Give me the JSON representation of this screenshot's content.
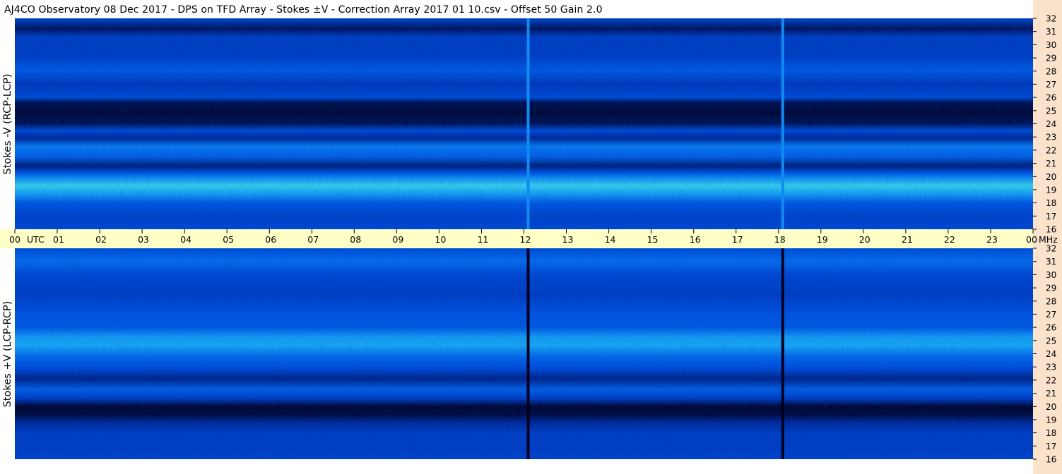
{
  "title": "AJ4CO Observatory  08 Dec 2017  -  DPS on TFD Array  -  Stokes ±V  -  Correction Array 2017 01 10.csv  -  Offset 50  Gain 2.0",
  "colors": {
    "time_axis_band": "#ffffc8",
    "freq_axis_strip": "#fbe2cc",
    "colormap": [
      "#000020",
      "#001050",
      "#0030b0",
      "#0050e0",
      "#0a78f0",
      "#1aa8f5",
      "#38d0ee",
      "#8ef0a8",
      "#f0ff60"
    ]
  },
  "chart_data": [
    {
      "type": "heatmap",
      "panel": "top",
      "ylabel": "Stokes -V (RCP-LCP)",
      "x_unit": "UTC",
      "y_unit": "MHz",
      "xlim": [
        0,
        24
      ],
      "ylim": [
        16,
        32
      ],
      "x_ticks": [
        "00",
        "01",
        "02",
        "03",
        "04",
        "05",
        "06",
        "07",
        "08",
        "09",
        "10",
        "11",
        "12",
        "13",
        "14",
        "15",
        "16",
        "17",
        "18",
        "19",
        "20",
        "21",
        "22",
        "23",
        "00"
      ],
      "y_ticks": [
        "16",
        "17",
        "18",
        "19",
        "20",
        "21",
        "22",
        "23",
        "24",
        "25",
        "26",
        "27",
        "28",
        "29",
        "30",
        "31",
        "32"
      ],
      "frequency_profile": [
        {
          "f": 32.0,
          "v": 0.33
        },
        {
          "f": 31.2,
          "v": 0.14
        },
        {
          "f": 30.6,
          "v": 0.3
        },
        {
          "f": 29.2,
          "v": 0.3
        },
        {
          "f": 28.0,
          "v": 0.4
        },
        {
          "f": 27.0,
          "v": 0.28
        },
        {
          "f": 26.0,
          "v": 0.35
        },
        {
          "f": 25.6,
          "v": 0.12
        },
        {
          "f": 24.8,
          "v": 0.06
        },
        {
          "f": 24.0,
          "v": 0.14
        },
        {
          "f": 23.5,
          "v": 0.35
        },
        {
          "f": 22.9,
          "v": 0.22
        },
        {
          "f": 22.3,
          "v": 0.5
        },
        {
          "f": 21.5,
          "v": 0.42
        },
        {
          "f": 20.8,
          "v": 0.18
        },
        {
          "f": 20.3,
          "v": 0.38
        },
        {
          "f": 19.9,
          "v": 0.55
        },
        {
          "f": 19.3,
          "v": 0.75
        },
        {
          "f": 18.7,
          "v": 0.6
        },
        {
          "f": 18.0,
          "v": 0.4
        },
        {
          "f": 17.0,
          "v": 0.32
        },
        {
          "f": 16.0,
          "v": 0.34
        }
      ],
      "vertical_lines": [
        {
          "utc": 12.1,
          "v": 0.55
        },
        {
          "utc": 18.1,
          "v": 0.55
        }
      ]
    },
    {
      "type": "heatmap",
      "panel": "bottom",
      "ylabel": "Stokes +V (LCP-RCP)",
      "x_unit": "UTC",
      "y_unit": "MHz",
      "xlim": [
        0,
        24
      ],
      "ylim": [
        16,
        32
      ],
      "y_ticks": [
        "16",
        "17",
        "18",
        "19",
        "20",
        "21",
        "22",
        "23",
        "24",
        "25",
        "26",
        "27",
        "28",
        "29",
        "30",
        "31",
        "32"
      ],
      "frequency_profile": [
        {
          "f": 32.0,
          "v": 0.36
        },
        {
          "f": 31.0,
          "v": 0.46
        },
        {
          "f": 30.0,
          "v": 0.34
        },
        {
          "f": 28.5,
          "v": 0.3
        },
        {
          "f": 27.0,
          "v": 0.38
        },
        {
          "f": 26.0,
          "v": 0.4
        },
        {
          "f": 25.2,
          "v": 0.6
        },
        {
          "f": 24.6,
          "v": 0.62
        },
        {
          "f": 23.8,
          "v": 0.45
        },
        {
          "f": 22.9,
          "v": 0.36
        },
        {
          "f": 22.1,
          "v": 0.2
        },
        {
          "f": 21.3,
          "v": 0.42
        },
        {
          "f": 20.6,
          "v": 0.3
        },
        {
          "f": 20.0,
          "v": 0.05
        },
        {
          "f": 19.4,
          "v": 0.08
        },
        {
          "f": 18.8,
          "v": 0.22
        },
        {
          "f": 18.0,
          "v": 0.3
        },
        {
          "f": 17.0,
          "v": 0.3
        },
        {
          "f": 16.0,
          "v": 0.32
        }
      ],
      "vertical_lines": [
        {
          "utc": 12.1,
          "v": 0.0
        },
        {
          "utc": 18.1,
          "v": 0.0
        }
      ]
    }
  ]
}
